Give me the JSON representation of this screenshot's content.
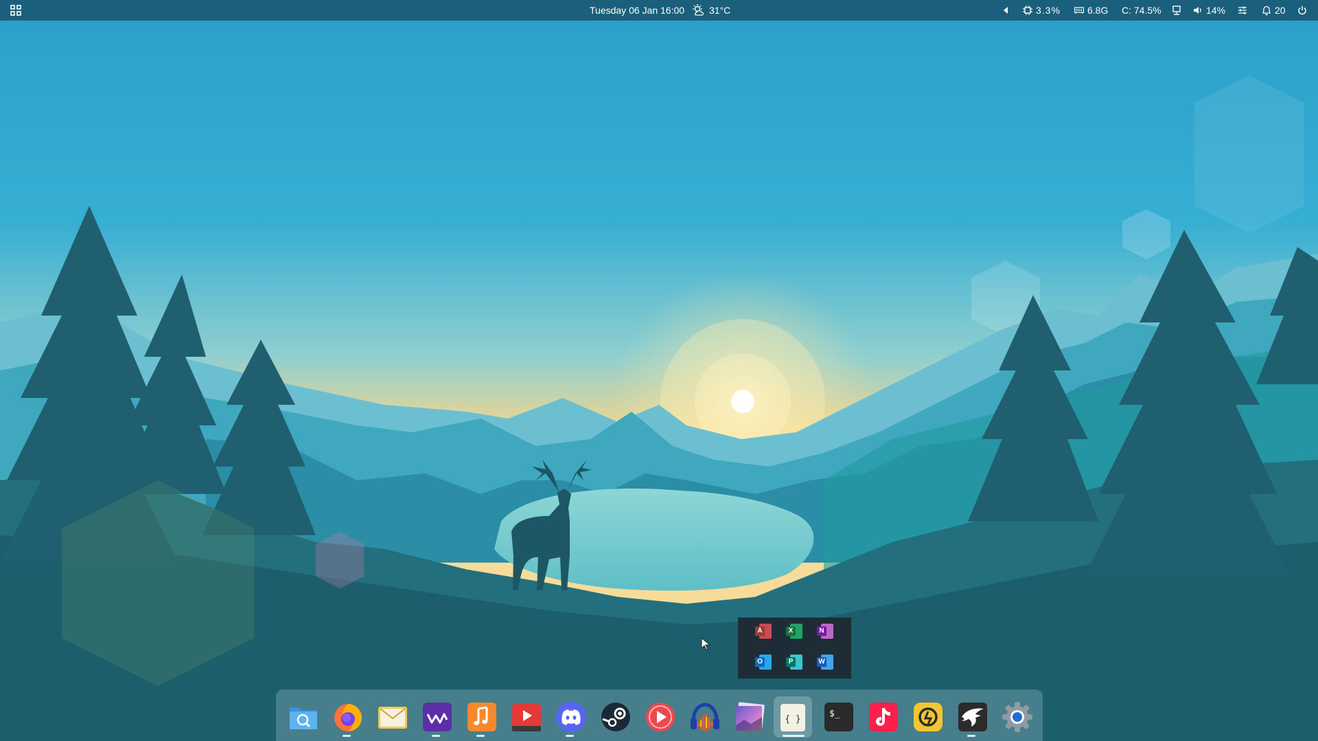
{
  "topbar": {
    "datetime": "Tuesday 06 Jan 16:00",
    "weather": "31°C",
    "cpu": "3.3%",
    "ram": "6.8G",
    "disk": "C: 74.5%",
    "volume": "14%",
    "notifications": "20",
    "icons": [
      "app-grid-icon",
      "weather-icon",
      "tray-arrow-icon",
      "cpu-icon",
      "memory-icon",
      "display-icon",
      "speaker-icon",
      "settings-sliders-icon",
      "bell-icon",
      "power-icon"
    ]
  },
  "dock": {
    "items": [
      {
        "name": "finder",
        "running": false
      },
      {
        "name": "firefox",
        "running": true
      },
      {
        "name": "mail",
        "running": false
      },
      {
        "name": "stremio",
        "running": true
      },
      {
        "name": "music",
        "running": true
      },
      {
        "name": "video-player",
        "running": false
      },
      {
        "name": "discord",
        "running": true
      },
      {
        "name": "steam",
        "running": false
      },
      {
        "name": "media-player",
        "running": false
      },
      {
        "name": "audacity",
        "running": false
      },
      {
        "name": "photos",
        "running": false
      },
      {
        "name": "code-editor",
        "running": true
      },
      {
        "name": "terminal",
        "running": false
      },
      {
        "name": "tiktok",
        "running": false
      },
      {
        "name": "sync",
        "running": false
      },
      {
        "name": "eagle",
        "running": true
      },
      {
        "name": "settings",
        "running": false
      }
    ],
    "terminal_glyph": "$_",
    "code_glyph": "{ }"
  },
  "office_popup": {
    "apps": [
      {
        "name": "access",
        "letter": "A",
        "color": "#a4373a"
      },
      {
        "name": "excel",
        "letter": "X",
        "color": "#1d7044"
      },
      {
        "name": "onenote",
        "letter": "N",
        "color": "#7719aa"
      },
      {
        "name": "outlook",
        "letter": "O",
        "color": "#0f6cbd"
      },
      {
        "name": "publisher",
        "letter": "P",
        "color": "#077568"
      },
      {
        "name": "word",
        "letter": "W",
        "color": "#185abd"
      }
    ]
  },
  "colors": {
    "topbar": "#1a5f7b",
    "sky_top": "#2ea3cc",
    "sky_horizon": "#f3d98e",
    "forest": "#1d5e6d"
  }
}
